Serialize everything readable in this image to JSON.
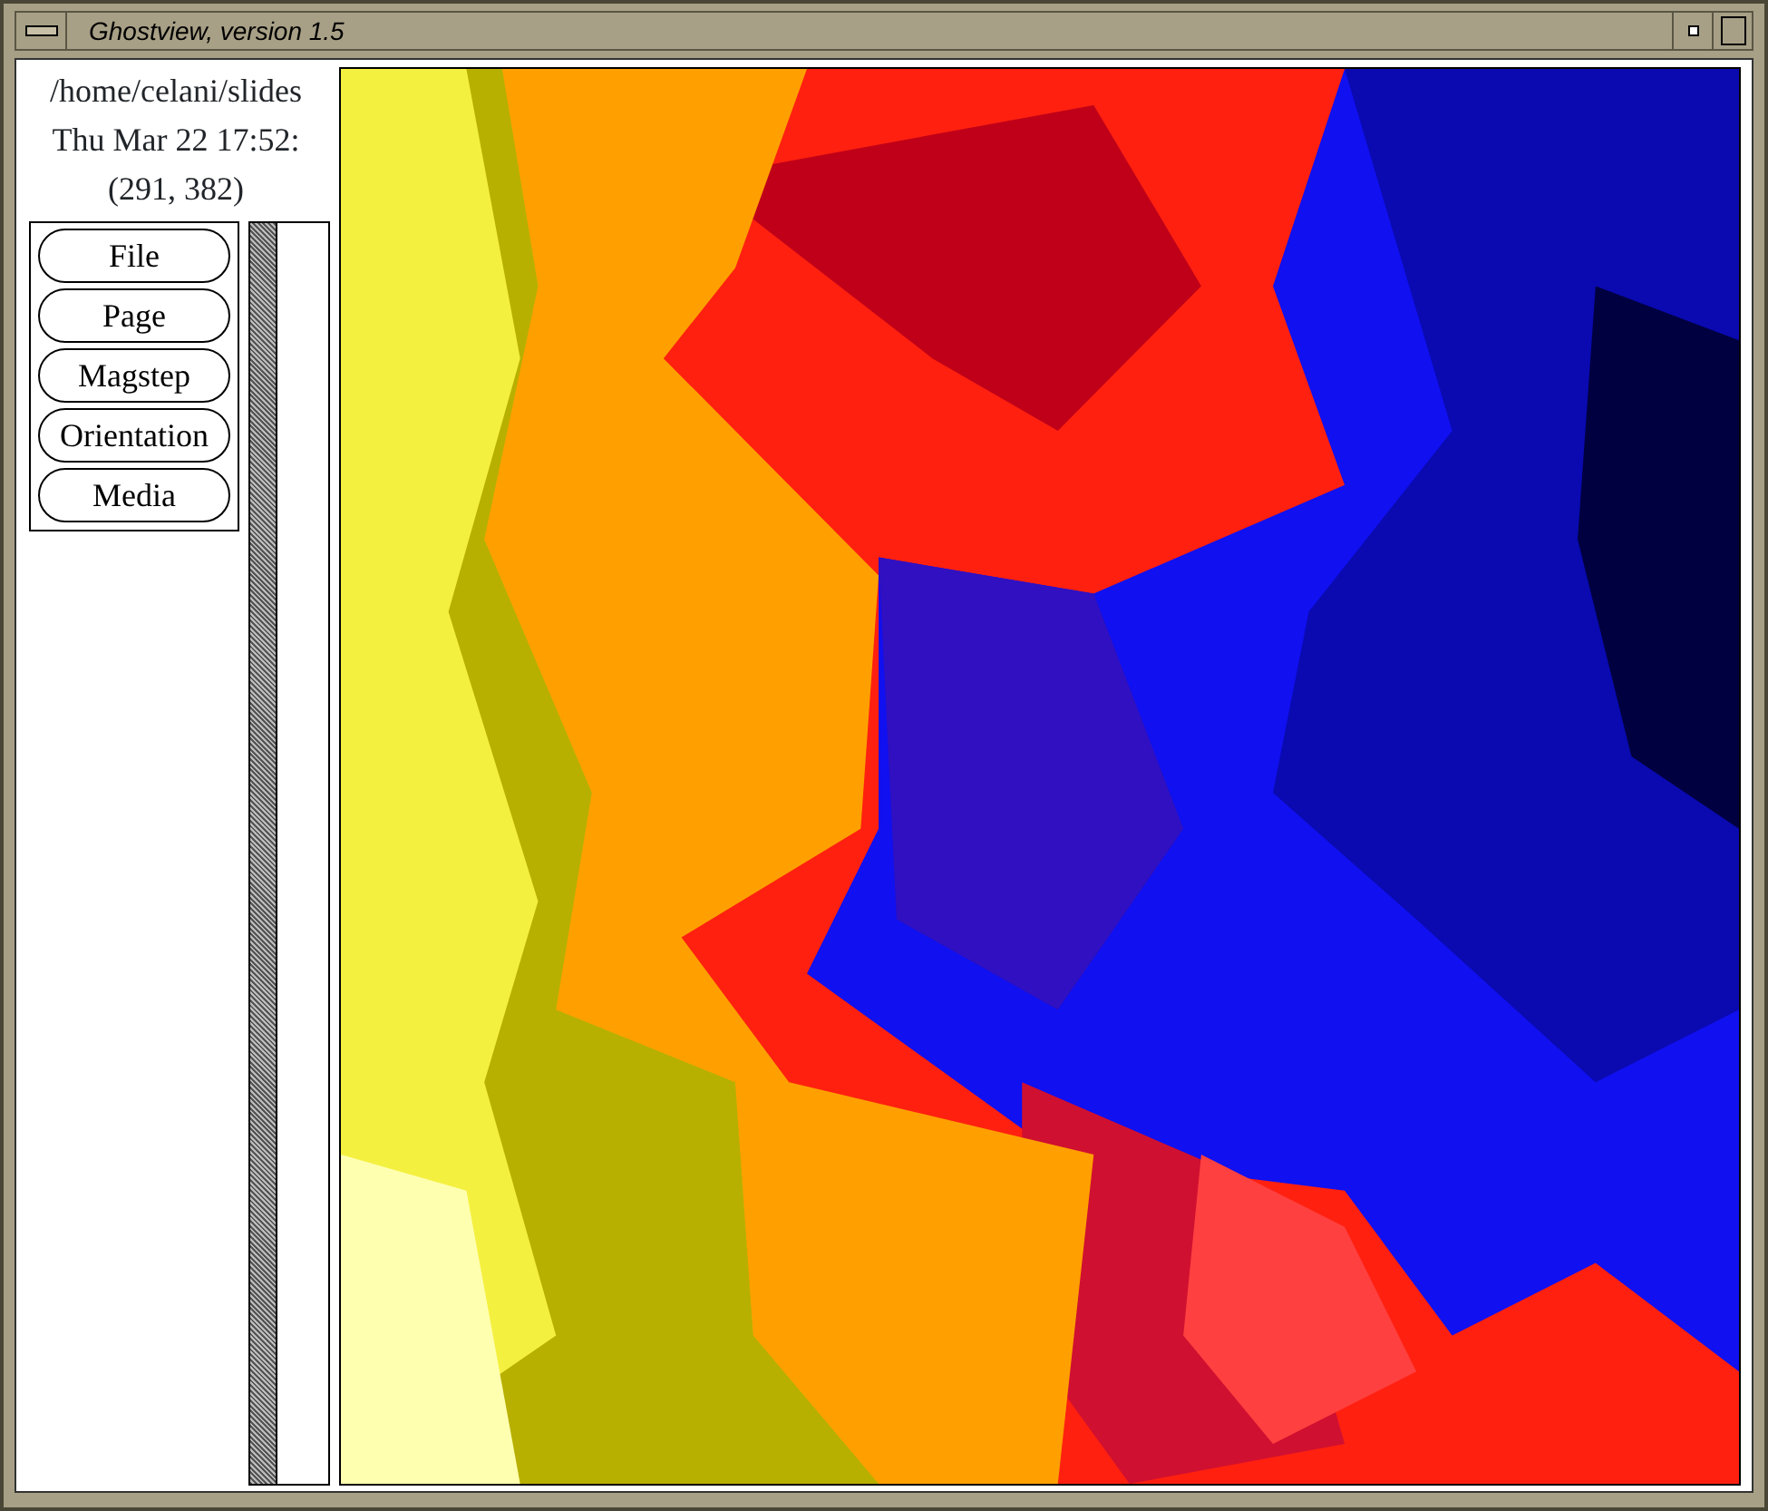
{
  "window": {
    "title": "Ghostview, version 1.5"
  },
  "info": [
    "/home/celani/slides",
    "Thu Mar 22 17:52:",
    "(291, 382)"
  ],
  "buttons": [
    "File",
    "Page",
    "Magstep",
    "Orientation",
    "Media"
  ]
}
